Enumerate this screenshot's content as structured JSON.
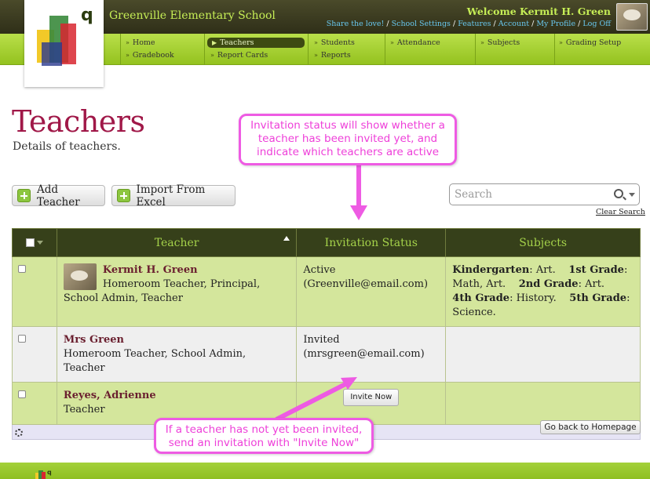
{
  "header": {
    "school_name": "Greenville Elementary School",
    "welcome": "Welcome Kermit H. Green",
    "links": [
      "Share the love!",
      "School Settings",
      "Features",
      "Account",
      "My Profile",
      "Log Off"
    ]
  },
  "nav": {
    "home": "Home",
    "gradebook": "Gradebook",
    "teachers": "Teachers",
    "report_cards": "Report Cards",
    "students": "Students",
    "reports": "Reports",
    "attendance": "Attendance",
    "subjects": "Subjects",
    "grading_setup": "Grading Setup"
  },
  "page": {
    "title": "Teachers",
    "subtitle": "Details of teachers."
  },
  "toolbar": {
    "add_teacher": "Add Teacher",
    "import_excel": "Import From Excel",
    "search_placeholder": "Search",
    "clear_search": "Clear Search"
  },
  "table": {
    "headers": {
      "teacher": "Teacher",
      "invitation": "Invitation Status",
      "subjects": "Subjects"
    },
    "rows": [
      {
        "name": "Kermit H. Green",
        "roles": "Homeroom Teacher, Principal, School Admin, Teacher",
        "status": "Active",
        "email": "(Greenville@email.com)",
        "subjects": [
          {
            "grade": "Kindergarten",
            "subject": "Art."
          },
          {
            "grade": "1st Grade",
            "subject": "Math, Art."
          },
          {
            "grade": "2nd Grade",
            "subject": "Art."
          },
          {
            "grade": "4th Grade",
            "subject": "History."
          },
          {
            "grade": "5th Grade",
            "subject": "Science."
          }
        ]
      },
      {
        "name": "Mrs Green",
        "roles": "Homeroom Teacher, School Admin, Teacher",
        "status": "Invited",
        "email": "(mrsgreen@email.com)"
      },
      {
        "name": "Reyes, Adrienne",
        "roles": "Teacher",
        "invite_button": "Invite Now"
      }
    ]
  },
  "back_button": "Go back to Homepage",
  "annotations": {
    "callout_top": "Invitation status will show whether a teacher has been invited yet, and indicate which teachers are active",
    "callout_bottom": "If a teacher has not yet been invited, send an invitation with \"Invite Now\"",
    "color": "#ee5be3"
  },
  "colors": {
    "header_dark": "#3a3a20",
    "nav_green": "#a6d23a",
    "title": "#a01848",
    "table_header": "#36401a",
    "row_green": "#d4e69c"
  }
}
